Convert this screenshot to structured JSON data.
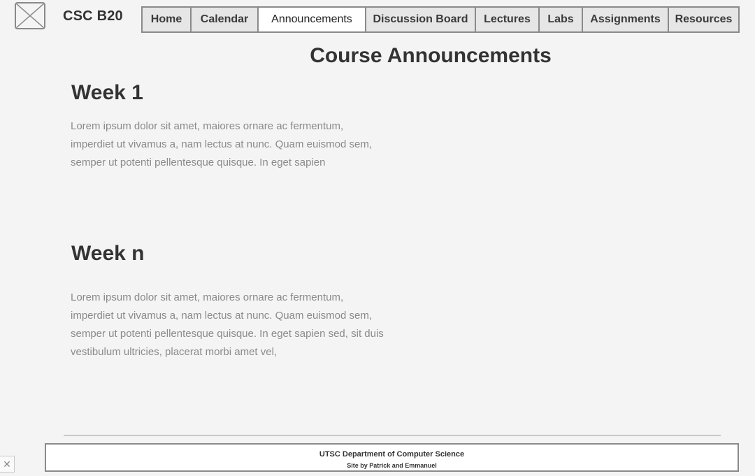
{
  "header": {
    "logo_icon": "image-placeholder-icon",
    "site_title": "CSC B20"
  },
  "nav": {
    "items": [
      {
        "label": "Home",
        "active": false
      },
      {
        "label": "Calendar",
        "active": false
      },
      {
        "label": "Announcements",
        "active": true
      },
      {
        "label": "Discussion Board",
        "active": false
      },
      {
        "label": "Lectures",
        "active": false
      },
      {
        "label": "Labs",
        "active": false
      },
      {
        "label": "Assignments",
        "active": false
      },
      {
        "label": "Resources",
        "active": false
      }
    ]
  },
  "main": {
    "page_title": "Course Announcements",
    "announcements": [
      {
        "title": "Week 1",
        "body": "Lorem ipsum dolor sit amet, maiores ornare ac fermentum, imperdiet ut vivamus a, nam lectus at nunc. Quam euismod sem, semper ut potenti pellentesque quisque. In eget sapien"
      },
      {
        "title": "Week n",
        "body": "Lorem ipsum dolor sit amet, maiores ornare ac fermentum, imperdiet ut vivamus a, nam lectus at nunc. Quam euismod sem, semper ut potenti pellentesque quisque. In eget sapien sed, sit duis vestibulum ultricies, placerat morbi amet vel,"
      }
    ]
  },
  "footer": {
    "line1": "UTSC Department of Computer Science",
    "line2": "Site by Patrick and Emmanuel"
  },
  "overlay": {
    "close_icon": "close-icon",
    "close_glyph": "✕"
  },
  "colors": {
    "background": "#f4f4f4",
    "border": "#8a8a8a",
    "text_dark": "#333333",
    "text_muted": "#8a8a8a",
    "active_tab": "#ffffff"
  }
}
